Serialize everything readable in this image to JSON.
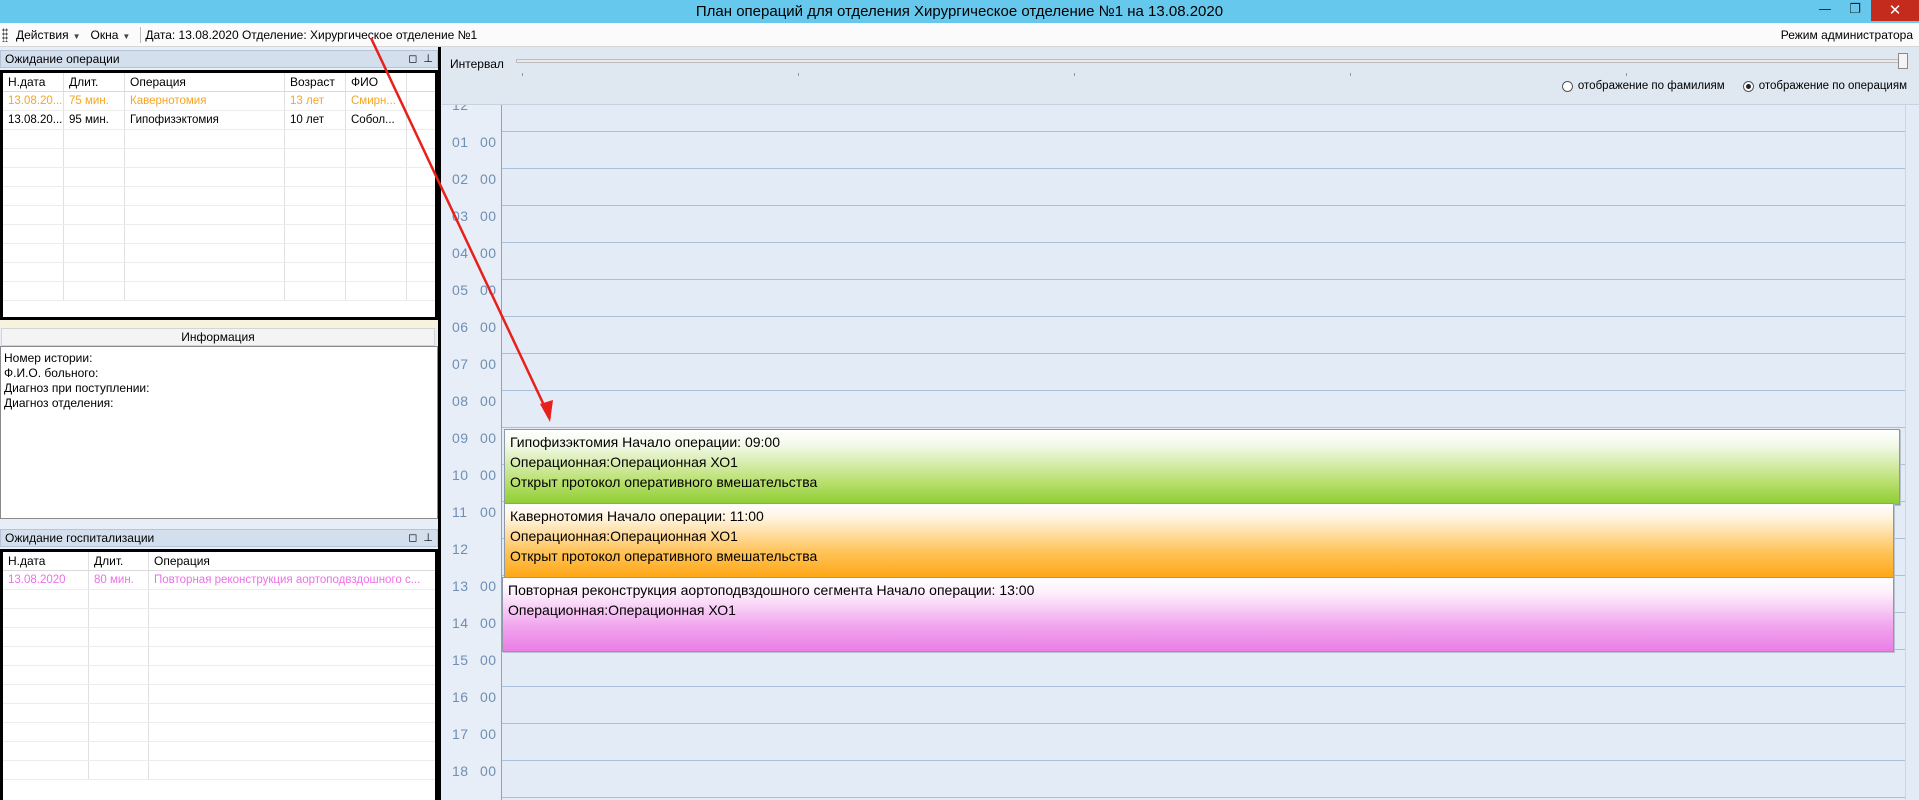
{
  "window": {
    "title": "План операций для отделения Хирургическое отделение №1 на 13.08.2020",
    "minimize": "—",
    "restore": "❐",
    "close": "✕"
  },
  "toolbar": {
    "actions_label": "Действия",
    "windows_label": "Окна",
    "info_text": "Дата: 13.08.2020 Отделение: Хирургическое отделение №1",
    "mode_label": "Режим администратора"
  },
  "waiting_operations": {
    "title": "Ожидание операции",
    "columns": [
      "Н.дата",
      "Длит.",
      "Операция",
      "Возраст",
      "ФИО"
    ],
    "rows": [
      {
        "date": "13.08.20...",
        "dur": "75 мин.",
        "op": "Кавернотомия",
        "age": "13 лет",
        "fio": "Смирн..."
      },
      {
        "date": "13.08.20...",
        "dur": "95 мин.",
        "op": "Гипофизэктомия",
        "age": "10 лет",
        "fio": "Собол..."
      }
    ]
  },
  "info_panel": {
    "title": "Информация",
    "history_label": "Номер истории:",
    "patient_label": "Ф.И.О. больного:",
    "admission_diag_label": "Диагноз при поступлении:",
    "dept_diag_label": "Диагноз отделения:"
  },
  "waiting_hospitalization": {
    "title": "Ожидание госпитализации",
    "columns": [
      "Н.дата",
      "Длит.",
      "Операция"
    ],
    "rows": [
      {
        "date": "13.08.2020",
        "dur": "80 мин.",
        "op": "Повторная реконструкция аортоподвздошного с..."
      }
    ]
  },
  "scheduler": {
    "interval_label": "Интервал",
    "slider_value": 1.0,
    "radio_by_surname": "отображение по фамилиям",
    "radio_by_operation": "отображение по операциям",
    "selected_view": "operations",
    "time_slots": [
      {
        "h": "12",
        "m": ""
      },
      {
        "h": "01",
        "m": "00"
      },
      {
        "h": "02",
        "m": "00"
      },
      {
        "h": "03",
        "m": "00"
      },
      {
        "h": "04",
        "m": "00"
      },
      {
        "h": "05",
        "m": "00"
      },
      {
        "h": "06",
        "m": "00"
      },
      {
        "h": "07",
        "m": "00"
      },
      {
        "h": "08",
        "m": "00"
      },
      {
        "h": "09",
        "m": "00"
      },
      {
        "h": "10",
        "m": "00"
      },
      {
        "h": "11",
        "m": "00"
      },
      {
        "h": "12",
        "m": ""
      },
      {
        "h": "13",
        "m": "00"
      },
      {
        "h": "14",
        "m": "00"
      },
      {
        "h": "15",
        "m": "00"
      },
      {
        "h": "16",
        "m": "00"
      },
      {
        "h": "17",
        "m": "00"
      },
      {
        "h": "18",
        "m": "00"
      }
    ],
    "appointments": [
      {
        "color": "green",
        "line1": "Гипофизэктомия Начало операции: 09:00",
        "line2": "Операционная:Операционная ХО1",
        "line3": "Открыт протокол оперативного вмешательства"
      },
      {
        "color": "orange",
        "line1": "Кавернотомия Начало операции: 11:00",
        "line2": "Операционная:Операционная ХО1",
        "line3": "Открыт протокол оперативного вмешательства"
      },
      {
        "color": "pink",
        "line1": "Повторная реконструкция аортоподвздошного сегмента Начало операции: 13:00",
        "line2": "Операционная:Операционная ХО1",
        "line3": ""
      }
    ]
  },
  "colors": {
    "titlebar": "#66c8ec",
    "green": "#8fcd33",
    "orange": "#ffa716",
    "pink": "#ea7ee6",
    "annotation_arrow": "#e8201c"
  }
}
